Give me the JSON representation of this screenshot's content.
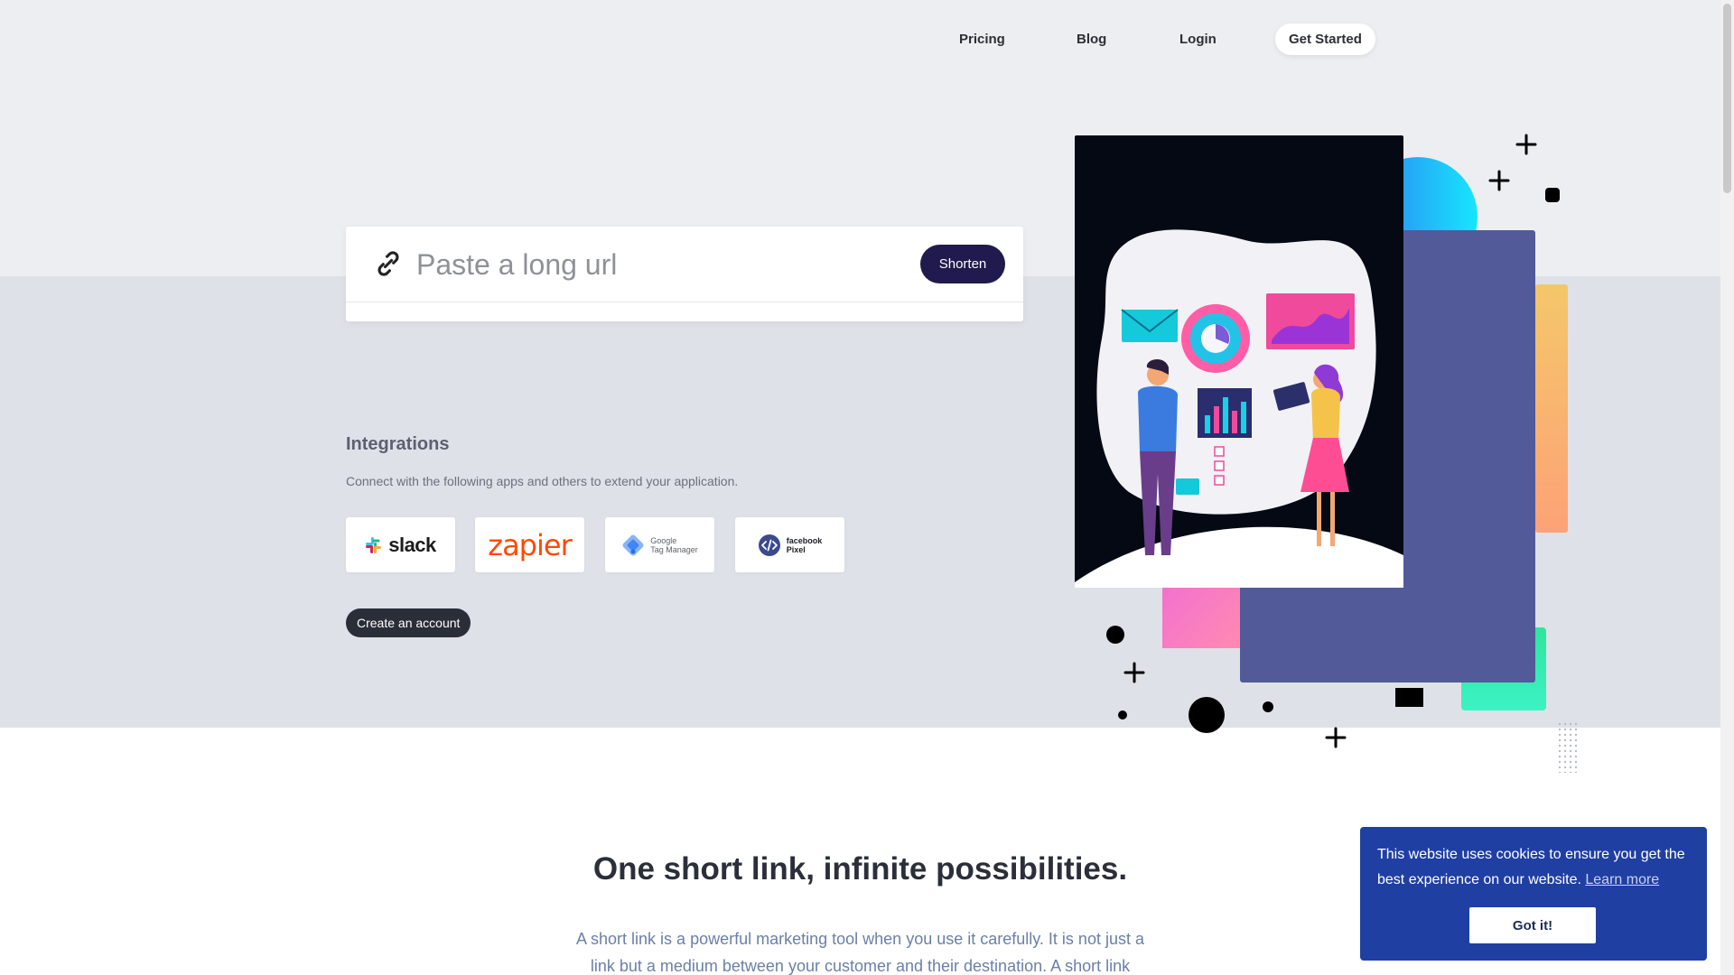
{
  "nav": {
    "pricing": "Pricing",
    "blog": "Blog",
    "login": "Login",
    "get_started": "Get Started"
  },
  "shortener": {
    "placeholder": "Paste a long url",
    "button": "Shorten",
    "icon": "link-icon"
  },
  "integrations": {
    "title": "Integrations",
    "description": "Connect with the following apps and others to extend your application.",
    "apps": [
      {
        "name": "slack",
        "label": "slack"
      },
      {
        "name": "zapier",
        "label": "zapier"
      },
      {
        "name": "google-tag-manager",
        "label_line1": "Google",
        "label_line2": "Tag Manager"
      },
      {
        "name": "facebook-pixel",
        "label_line1": "facebook",
        "label_line2": "Pixel"
      }
    ],
    "cta": "Create an account"
  },
  "section": {
    "title": "One short link, infinite possibilities.",
    "text": "A short link is a powerful marketing tool when you use it carefully. It is not just a link but a medium between your customer and their destination. A short link"
  },
  "cookie": {
    "message": "This website uses cookies to ensure you get the best experience on our website.",
    "learn_more": "Learn more",
    "accept": "Got it!"
  },
  "colors": {
    "accent": "#201a4e",
    "cookie_bg": "#1f3fa3",
    "zapier": "#ff4a00"
  }
}
